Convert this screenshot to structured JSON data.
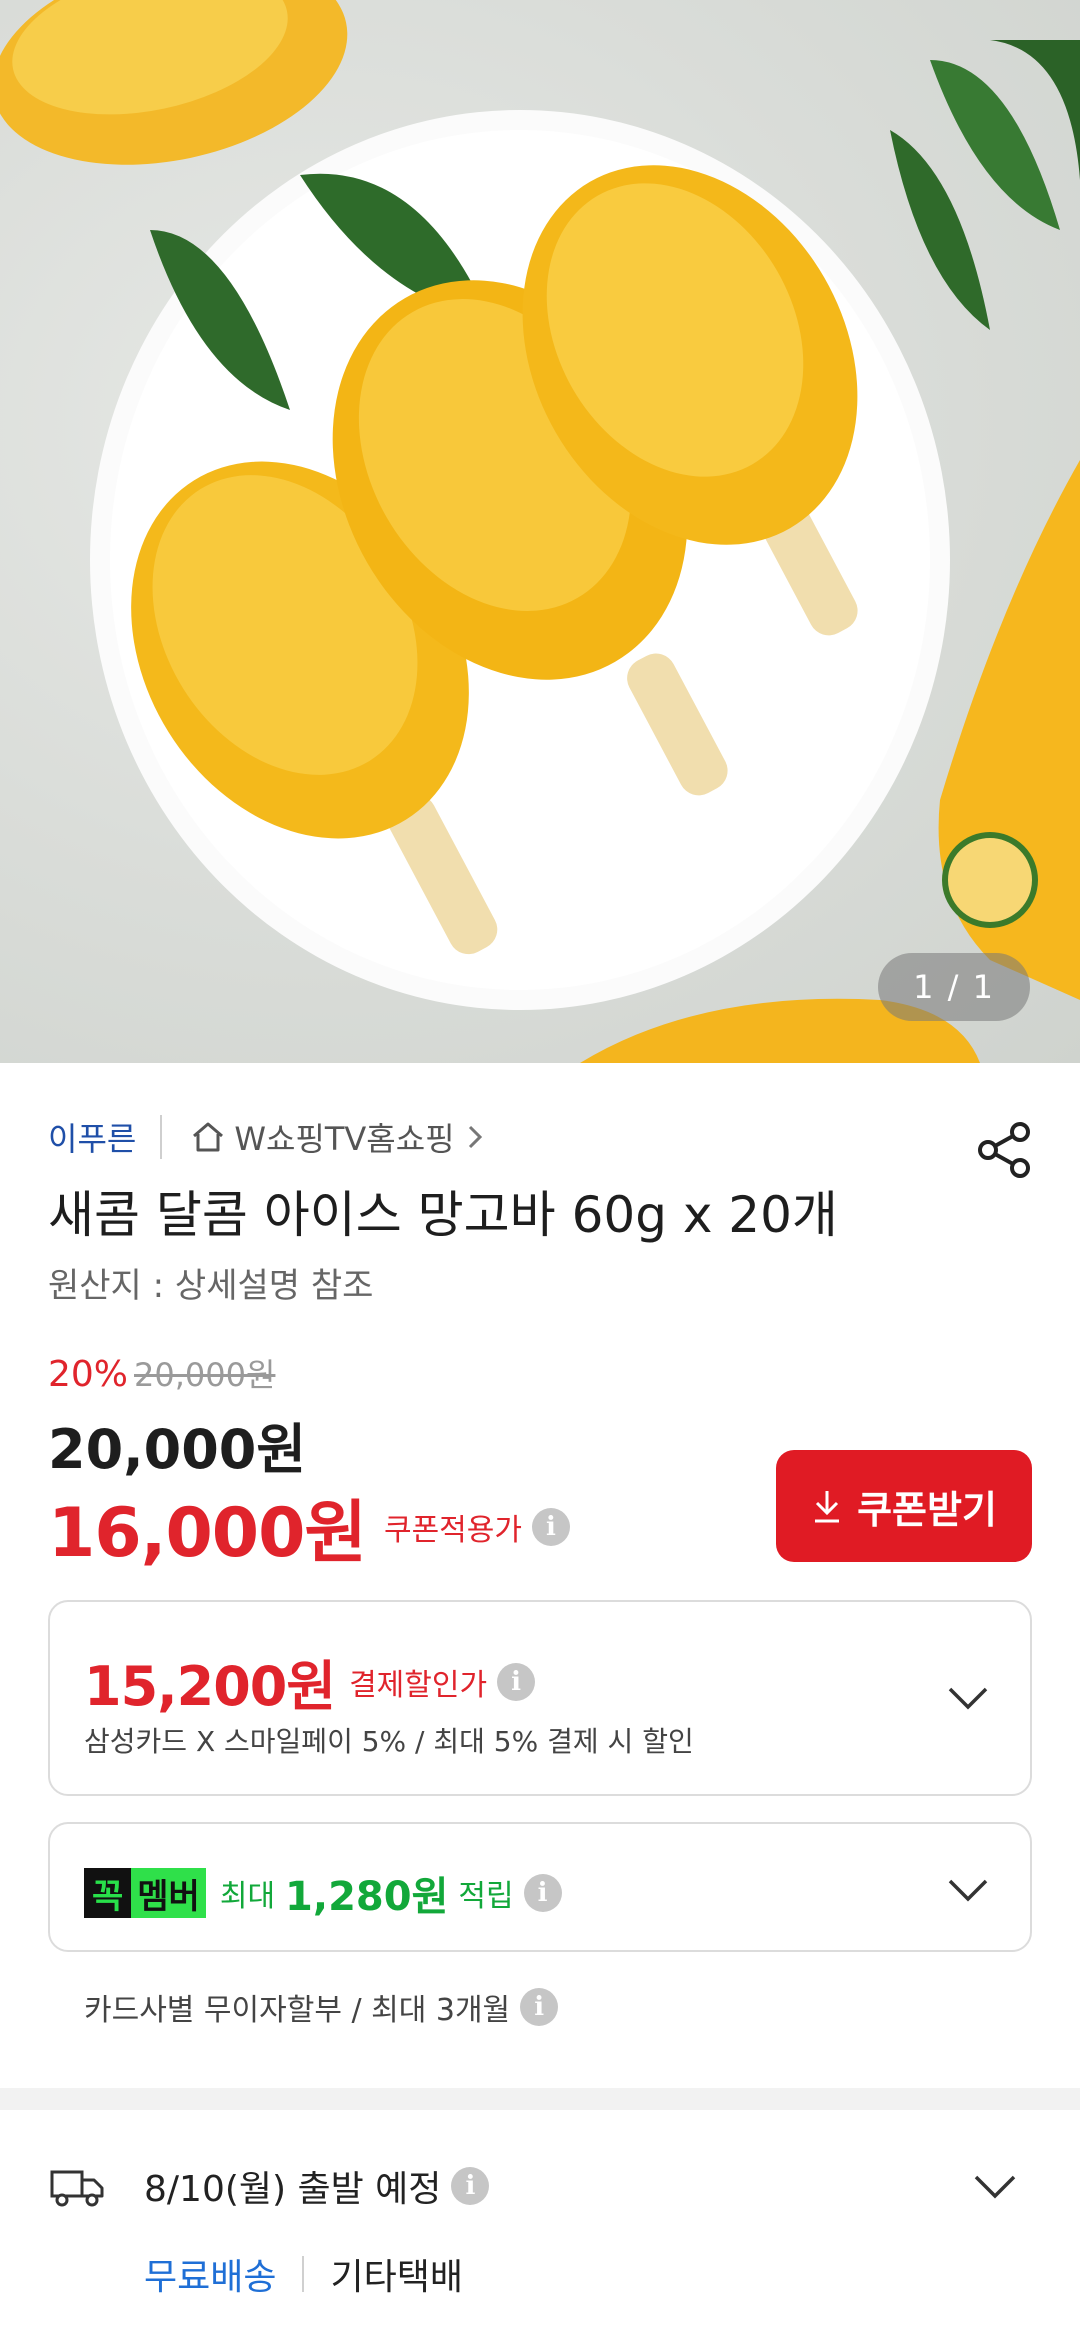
{
  "hero": {
    "counter": "1 / 1"
  },
  "seller": {
    "brand": "이푸른",
    "store": "W쇼핑TV홈쇼핑"
  },
  "product": {
    "title": "새콤 달콤 아이스 망고바 60g x 20개",
    "origin": "원산지 : 상세설명 참조"
  },
  "pricing": {
    "discount_rate": "20%",
    "original_price": "20,000원",
    "price": "20,000원",
    "coupon_price": "16,000원",
    "coupon_label": "쿠폰적용가",
    "coupon_button": "쿠폰받기"
  },
  "payment_card": {
    "price": "15,200원",
    "label": "결제할인가",
    "detail": "삼성카드 X 스마일페이 5%  / 최대 5% 결제 시 할인"
  },
  "member_card": {
    "badge_left": "꼭",
    "badge_right": "멤버",
    "prefix": "최대",
    "amount": "1,280원",
    "suffix": "적립"
  },
  "installment": "카드사별 무이자할부 / 최대 3개월",
  "shipping": {
    "date": "8/10(월) 출발 예정",
    "free": "무료배송",
    "carrier": "기타택배"
  },
  "colors": {
    "accent_red": "#e0242c",
    "member_green": "#12a83a",
    "link_blue": "#1f6fd6"
  },
  "icons": [
    "home-icon",
    "chevron-right-icon",
    "share-icon",
    "download-icon",
    "info-icon",
    "chevron-down-icon",
    "truck-icon"
  ]
}
